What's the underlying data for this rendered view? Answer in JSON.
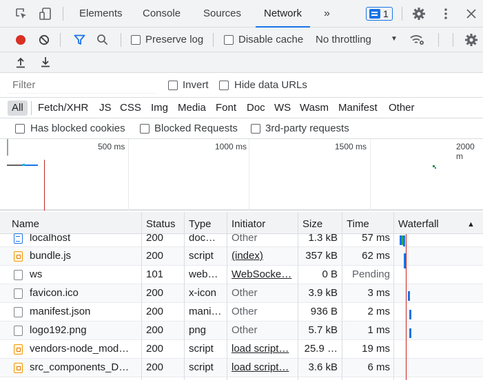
{
  "tabs": {
    "elements": "Elements",
    "console": "Console",
    "sources": "Sources",
    "network": "Network",
    "more": "»",
    "issues_count": "1"
  },
  "toolbar": {
    "preserve_log": "Preserve log",
    "disable_cache": "Disable cache",
    "throttling": "No throttling",
    "throttling_arrow": "▼"
  },
  "filter": {
    "placeholder": "Filter",
    "invert": "Invert",
    "hide_data_urls": "Hide data URLs"
  },
  "type_filters": [
    "All",
    "Fetch/XHR",
    "JS",
    "CSS",
    "Img",
    "Media",
    "Font",
    "Doc",
    "WS",
    "Wasm",
    "Manifest",
    "Other"
  ],
  "blocking": {
    "has_blocked_cookies": "Has blocked cookies",
    "blocked_requests": "Blocked Requests",
    "third_party": "3rd-party requests"
  },
  "overview": {
    "ticks": [
      "500 ms",
      "1000 ms",
      "1500 ms",
      "2000 m"
    ]
  },
  "table": {
    "headers": {
      "name": "Name",
      "status": "Status",
      "type": "Type",
      "initiator": "Initiator",
      "size": "Size",
      "time": "Time",
      "waterfall": "Waterfall",
      "sort_icon": "▲"
    },
    "rows": [
      {
        "name": "localhost",
        "status": "200",
        "type": "doc…",
        "initiator": "Other",
        "size": "1.3 kB",
        "time": "57 ms",
        "icon": "document-icon"
      },
      {
        "name": "bundle.js",
        "status": "200",
        "type": "script",
        "initiator": "(index)",
        "size": "357 kB",
        "time": "62 ms",
        "icon": "script-icon"
      },
      {
        "name": "ws",
        "status": "101",
        "type": "web…",
        "initiator": "WebSocke…",
        "size": "0 B",
        "time": "Pending",
        "icon": "file-icon"
      },
      {
        "name": "favicon.ico",
        "status": "200",
        "type": "x-icon",
        "initiator": "Other",
        "size": "3.9 kB",
        "time": "3 ms",
        "icon": "file-icon"
      },
      {
        "name": "manifest.json",
        "status": "200",
        "type": "mani…",
        "initiator": "Other",
        "size": "936 B",
        "time": "2 ms",
        "icon": "file-icon"
      },
      {
        "name": "logo192.png",
        "status": "200",
        "type": "png",
        "initiator": "Other",
        "size": "5.7 kB",
        "time": "1 ms",
        "icon": "file-icon"
      },
      {
        "name": "vendors-node_mod…",
        "status": "200",
        "type": "script",
        "initiator": "load script…",
        "size": "25.9 …",
        "time": "19 ms",
        "icon": "script-icon"
      },
      {
        "name": "src_components_D…",
        "status": "200",
        "type": "script",
        "initiator": "load script…",
        "size": "3.6 kB",
        "time": "6 ms",
        "icon": "script-icon"
      }
    ]
  },
  "colors": {
    "accent": "#1a73e8",
    "record": "#d93025",
    "marker": "#c5221f"
  }
}
